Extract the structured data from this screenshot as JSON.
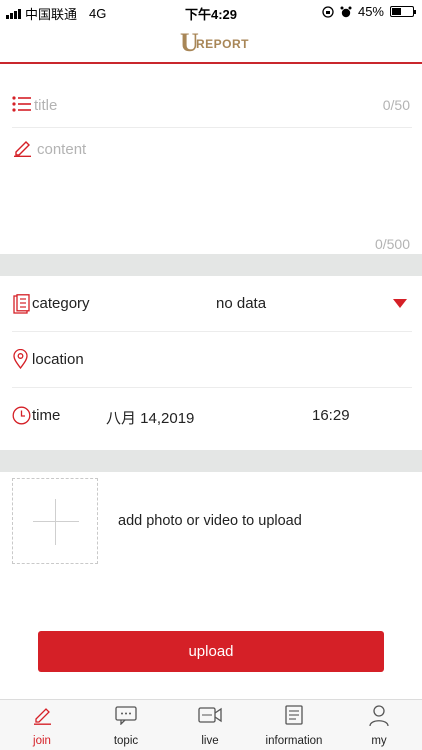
{
  "status_bar": {
    "carrier": "中国联通",
    "network": "4G",
    "time": "下午4:29",
    "battery": "45%",
    "battery_level": 0.45
  },
  "header": {
    "logo_letter": "U",
    "logo_text": "REPORT"
  },
  "form": {
    "title_placeholder": "title",
    "title_counter": "0/50",
    "content_placeholder": "content",
    "content_counter": "0/500",
    "category_label": "category",
    "category_value": "no data",
    "location_label": "location",
    "time_label": "time",
    "date_value": "八月 14,2019",
    "time_value": "16:29",
    "media_label": "add photo or video to upload",
    "upload_label": "upload"
  },
  "colors": {
    "accent": "#d52027",
    "logo": "#a88657",
    "divider": "#e4e6e5"
  },
  "tabs": [
    {
      "label": "join",
      "icon": "edit-icon",
      "active": true
    },
    {
      "label": "topic",
      "icon": "chat-icon",
      "active": false
    },
    {
      "label": "live",
      "icon": "live-camera-icon",
      "active": false
    },
    {
      "label": "information",
      "icon": "document-icon",
      "active": false
    },
    {
      "label": "my",
      "icon": "person-icon",
      "active": false
    }
  ]
}
